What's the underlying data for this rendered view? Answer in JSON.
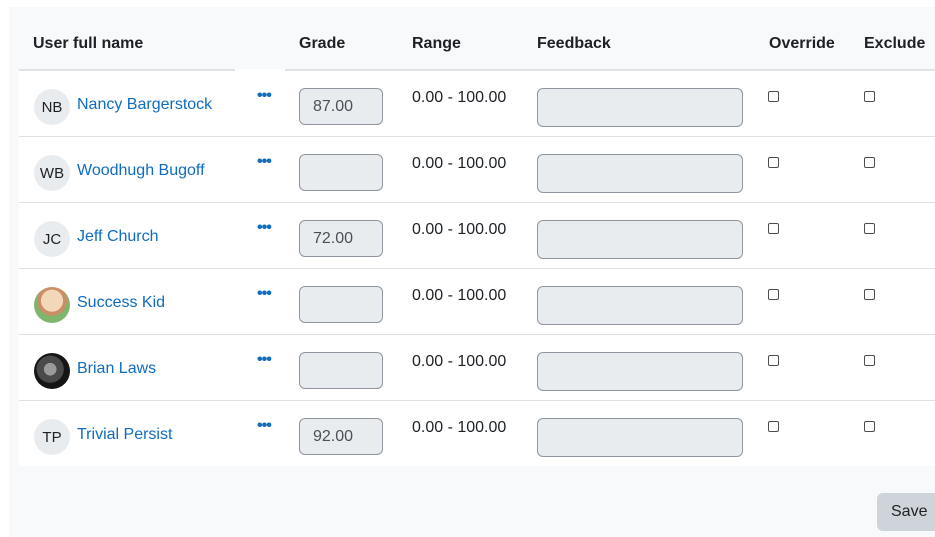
{
  "headers": {
    "name": "User full name",
    "grade": "Grade",
    "range": "Range",
    "feedback": "Feedback",
    "override": "Override",
    "exclude": "Exclude"
  },
  "rows": [
    {
      "initials": "NB",
      "name": "Nancy Bargerstock",
      "grade": "87.00",
      "range": "0.00 - 100.00",
      "feedback": "",
      "override": false,
      "exclude": false
    },
    {
      "initials": "WB",
      "name": "Woodhugh Bugoff",
      "grade": "",
      "range": "0.00 - 100.00",
      "feedback": "",
      "override": false,
      "exclude": false
    },
    {
      "initials": "JC",
      "name": "Jeff Church",
      "grade": "72.00",
      "range": "0.00 - 100.00",
      "feedback": "",
      "override": false,
      "exclude": false
    },
    {
      "initials": "",
      "name": "Success Kid",
      "grade": "",
      "range": "0.00 - 100.00",
      "feedback": "",
      "override": false,
      "exclude": false
    },
    {
      "initials": "",
      "name": "Brian Laws",
      "grade": "",
      "range": "0.00 - 100.00",
      "feedback": "",
      "override": false,
      "exclude": false
    },
    {
      "initials": "TP",
      "name": "Trivial Persist",
      "grade": "92.00",
      "range": "0.00 - 100.00",
      "feedback": "",
      "override": false,
      "exclude": false
    }
  ],
  "actions_icon": "more-actions-icon",
  "save_label": "Save",
  "colors": {
    "link": "#0f6cbf",
    "input_bg": "#e9ecef",
    "button_bg": "#ced4da"
  }
}
